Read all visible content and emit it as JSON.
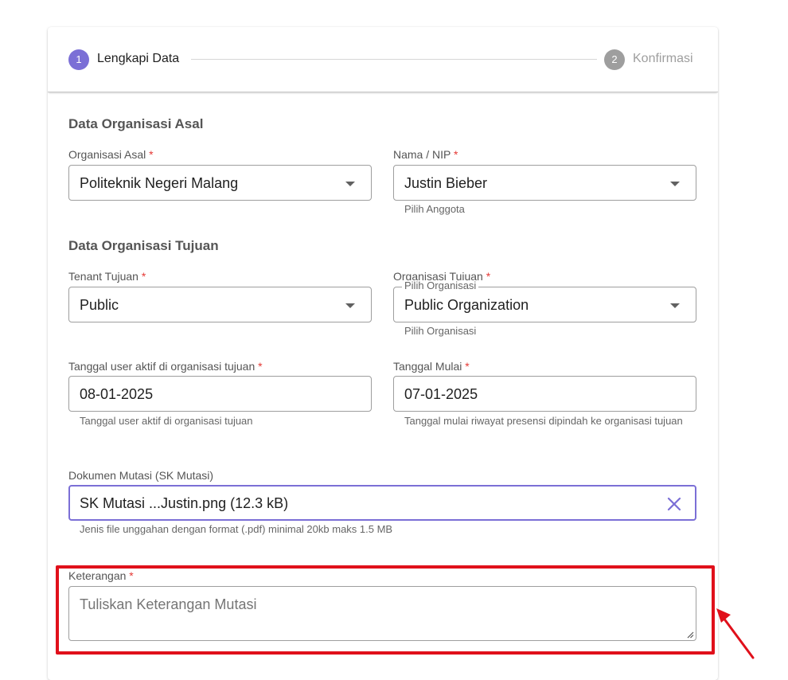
{
  "stepper": {
    "steps": [
      {
        "number": "1",
        "label": "Lengkapi Data",
        "active": true
      },
      {
        "number": "2",
        "label": "Konfirmasi",
        "active": false
      }
    ],
    "active_color": "#7b6fd6",
    "inactive_color": "#9e9e9e"
  },
  "origin_section": {
    "title": "Data Organisasi Asal",
    "organisasi_asal": {
      "label": "Organisasi Asal",
      "required_mark": "*",
      "value": "Politeknik Negeri Malang",
      "icon": "chevron-down-icon"
    },
    "nama_nip": {
      "label": "Nama / NIP",
      "required_mark": "*",
      "value": "Justin Bieber",
      "hint": "Pilih Anggota",
      "icon": "chevron-down-icon"
    }
  },
  "target_section": {
    "title": "Data Organisasi Tujuan",
    "tenant_tujuan": {
      "label": "Tenant Tujuan",
      "required_mark": "*",
      "value": "Public",
      "icon": "chevron-down-icon"
    },
    "organisasi_tujuan": {
      "label": "Organisasi Tujuan",
      "required_mark": "*",
      "floating_label": "Pilih Organisasi",
      "value": "Public Organization",
      "hint": "Pilih Organisasi",
      "icon": "chevron-down-icon"
    },
    "tanggal_aktif": {
      "label": "Tanggal user aktif di organisasi tujuan",
      "required_mark": "*",
      "value": "08-01-2025",
      "hint": "Tanggal user aktif di organisasi tujuan"
    },
    "tanggal_mulai": {
      "label": "Tanggal Mulai",
      "required_mark": "*",
      "value": "07-01-2025",
      "hint": "Tanggal mulai riwayat presensi dipindah ke organisasi tujuan"
    }
  },
  "dokumen": {
    "label": "Dokumen Mutasi (SK Mutasi)",
    "value": "SK Mutasi ...Justin.png (12.3 kB)",
    "hint": "Jenis file unggahan dengan format (.pdf) minimal 20kb maks 1.5 MB",
    "clear_icon": "close-icon",
    "focus_color": "#7b6fd6"
  },
  "keterangan": {
    "label": "Keterangan",
    "required_mark": "*",
    "placeholder": "Tuliskan Keterangan Mutasi"
  },
  "annotation": {
    "color": "#e0101b"
  }
}
